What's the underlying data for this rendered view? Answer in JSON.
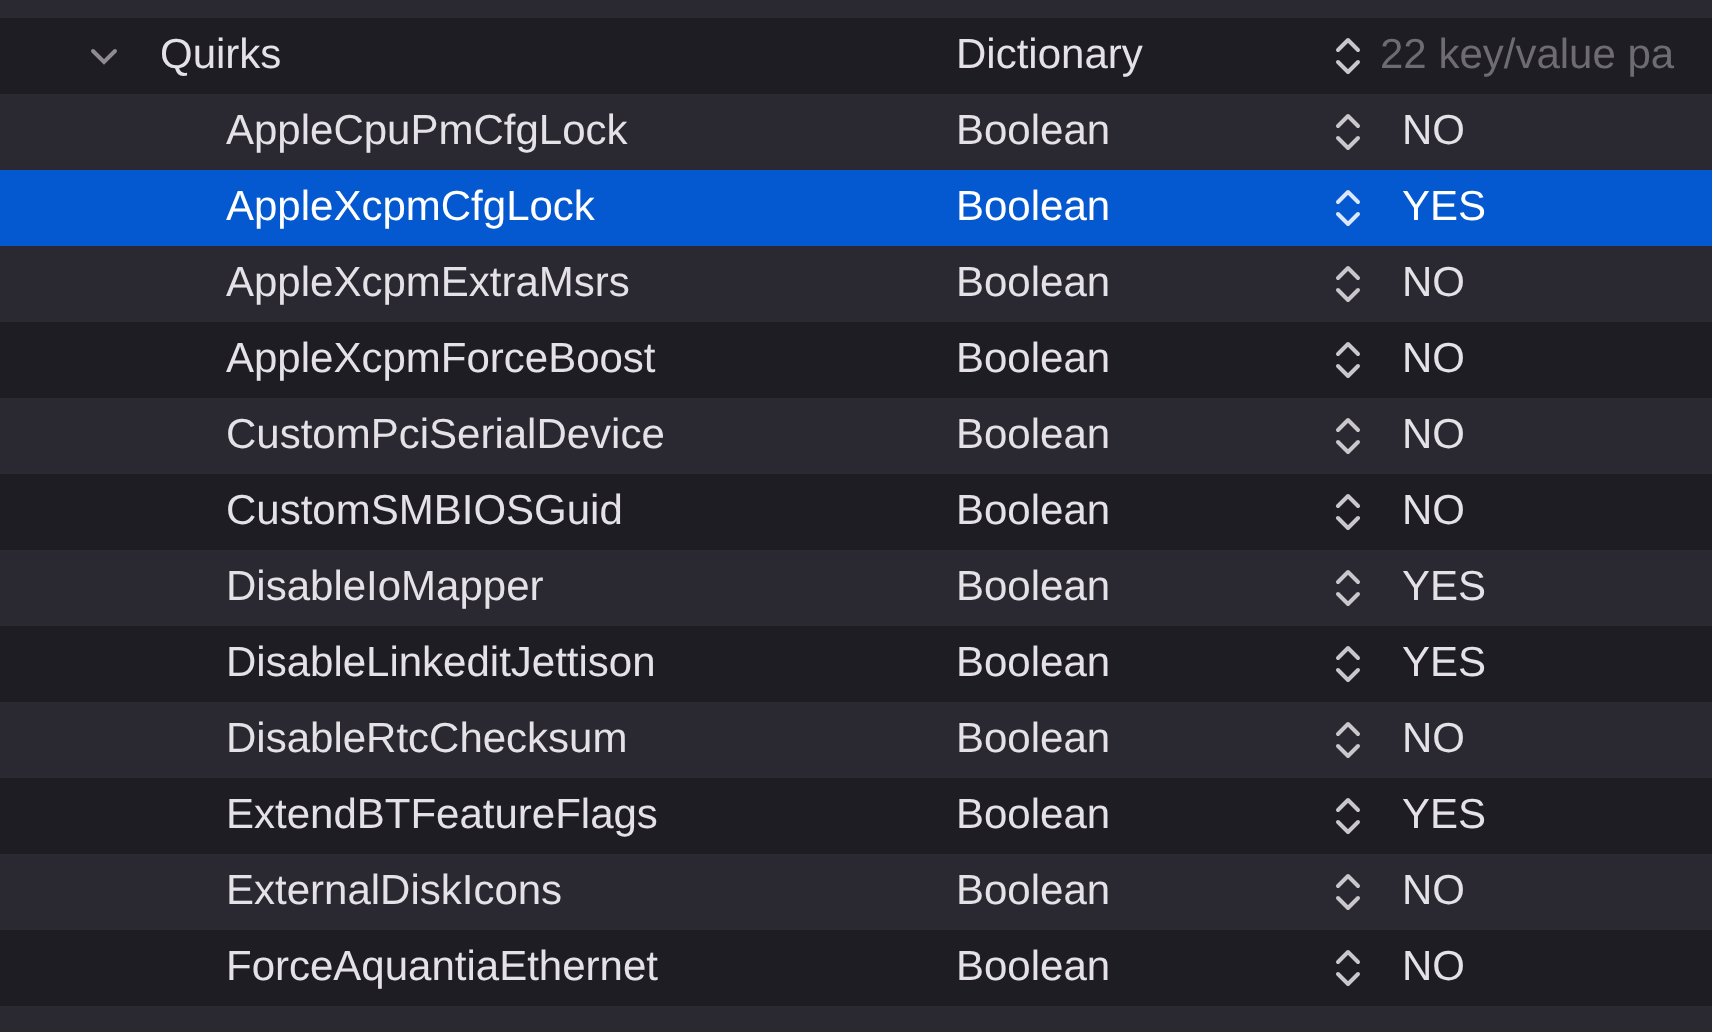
{
  "rows": [
    {
      "key": "Quirks",
      "type": "Dictionary",
      "value": "22 key/value pa",
      "expanded": true,
      "selected": false,
      "children": [
        {
          "key": "AppleCpuPmCfgLock",
          "type": "Boolean",
          "value": "NO",
          "selected": false
        },
        {
          "key": "AppleXcpmCfgLock",
          "type": "Boolean",
          "value": "YES",
          "selected": true
        },
        {
          "key": "AppleXcpmExtraMsrs",
          "type": "Boolean",
          "value": "NO",
          "selected": false
        },
        {
          "key": "AppleXcpmForceBoost",
          "type": "Boolean",
          "value": "NO",
          "selected": false
        },
        {
          "key": "CustomPciSerialDevice",
          "type": "Boolean",
          "value": "NO",
          "selected": false
        },
        {
          "key": "CustomSMBIOSGuid",
          "type": "Boolean",
          "value": "NO",
          "selected": false
        },
        {
          "key": "DisableIoMapper",
          "type": "Boolean",
          "value": "YES",
          "selected": false
        },
        {
          "key": "DisableLinkeditJettison",
          "type": "Boolean",
          "value": "YES",
          "selected": false
        },
        {
          "key": "DisableRtcChecksum",
          "type": "Boolean",
          "value": "NO",
          "selected": false
        },
        {
          "key": "ExtendBTFeatureFlags",
          "type": "Boolean",
          "value": "YES",
          "selected": false
        },
        {
          "key": "ExternalDiskIcons",
          "type": "Boolean",
          "value": "NO",
          "selected": false
        },
        {
          "key": "ForceAquantiaEthernet",
          "type": "Boolean",
          "value": "NO",
          "selected": false
        }
      ]
    }
  ]
}
